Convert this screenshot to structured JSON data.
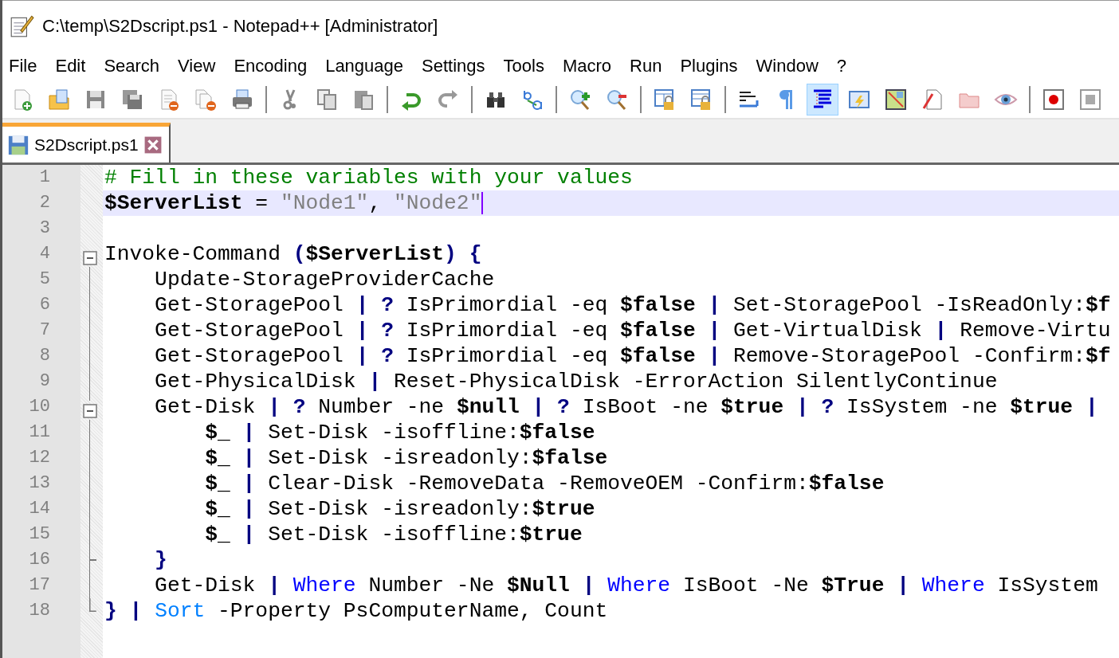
{
  "window": {
    "title": "C:\\temp\\S2Dscript.ps1 - Notepad++ [Administrator]"
  },
  "menu": [
    "File",
    "Edit",
    "Search",
    "View",
    "Encoding",
    "Language",
    "Settings",
    "Tools",
    "Macro",
    "Run",
    "Plugins",
    "Window",
    "?"
  ],
  "toolbar": {
    "groups": [
      {
        "buttons": [
          {
            "selected": false
          },
          {
            "selected": false
          },
          {
            "selected": false
          },
          {
            "selected": false
          },
          {
            "selected": false
          },
          {
            "selected": false
          },
          {
            "selected": false
          }
        ]
      },
      {
        "buttons": [
          {
            "selected": false
          },
          {
            "selected": false
          },
          {
            "selected": false
          }
        ]
      },
      {
        "buttons": [
          {
            "selected": false
          },
          {
            "selected": false
          }
        ]
      },
      {
        "buttons": [
          {
            "selected": false
          },
          {
            "selected": false
          }
        ]
      },
      {
        "buttons": [
          {
            "selected": false
          },
          {
            "selected": false
          }
        ]
      },
      {
        "buttons": [
          {
            "selected": false
          },
          {
            "selected": false
          }
        ]
      },
      {
        "buttons": [
          {
            "selected": false
          },
          {
            "selected": false
          },
          {
            "selected": true
          },
          {
            "selected": false
          },
          {
            "selected": false
          },
          {
            "selected": false
          },
          {
            "selected": false
          },
          {
            "selected": false
          }
        ]
      },
      {
        "buttons": [
          {
            "selected": false
          },
          {
            "selected": false
          }
        ]
      }
    ]
  },
  "tabs": [
    {
      "label": "S2Dscript.ps1",
      "selected": true
    }
  ],
  "editor": {
    "lines": [
      {
        "number": "1",
        "kind": "plain",
        "tokens": [
          {
            "kind": "comment",
            "text": "# Fill in these variables with your values"
          }
        ]
      },
      {
        "number": "2",
        "kind": "plain",
        "current": true,
        "tokens": [
          {
            "kind": "var",
            "text": "$ServerList"
          },
          {
            "kind": "plain",
            "text": " = "
          },
          {
            "kind": "string",
            "text": "\"Node1\""
          },
          {
            "kind": "plain",
            "text": ", "
          },
          {
            "kind": "string",
            "text": "\"Node2\""
          }
        ]
      },
      {
        "number": "3",
        "kind": "plain"
      },
      {
        "number": "4",
        "kind": "start",
        "tokens": [
          {
            "kind": "plain",
            "text": "Invoke-Command "
          },
          {
            "kind": "op",
            "text": "("
          },
          {
            "kind": "var",
            "text": "$ServerList"
          },
          {
            "kind": "op",
            "text": ") {"
          }
        ]
      },
      {
        "number": "5",
        "kind": "body",
        "tokens": [
          {
            "kind": "plain",
            "text": "    Update-StorageProviderCache"
          }
        ]
      },
      {
        "number": "6",
        "kind": "body",
        "tokens": [
          {
            "kind": "plain",
            "text": "    Get-StoragePool "
          },
          {
            "kind": "op",
            "text": "| ? "
          },
          {
            "kind": "plain",
            "text": "IsPrimordial -eq "
          },
          {
            "kind": "var",
            "text": "$false"
          },
          {
            "kind": "op",
            "text": " | "
          },
          {
            "kind": "plain",
            "text": "Set-StoragePool -IsReadOnly:"
          },
          {
            "kind": "var",
            "text": "$f"
          }
        ]
      },
      {
        "number": "7",
        "kind": "body",
        "tokens": [
          {
            "kind": "plain",
            "text": "    Get-StoragePool "
          },
          {
            "kind": "op",
            "text": "| ? "
          },
          {
            "kind": "plain",
            "text": "IsPrimordial -eq "
          },
          {
            "kind": "var",
            "text": "$false"
          },
          {
            "kind": "op",
            "text": " | "
          },
          {
            "kind": "plain",
            "text": "Get-VirtualDisk "
          },
          {
            "kind": "op",
            "text": "| "
          },
          {
            "kind": "plain",
            "text": "Remove-Virtu"
          }
        ]
      },
      {
        "number": "8",
        "kind": "body",
        "tokens": [
          {
            "kind": "plain",
            "text": "    Get-StoragePool "
          },
          {
            "kind": "op",
            "text": "| ? "
          },
          {
            "kind": "plain",
            "text": "IsPrimordial -eq "
          },
          {
            "kind": "var",
            "text": "$false"
          },
          {
            "kind": "op",
            "text": " | "
          },
          {
            "kind": "plain",
            "text": "Remove-StoragePool -Confirm:"
          },
          {
            "kind": "var",
            "text": "$f"
          }
        ]
      },
      {
        "number": "9",
        "kind": "body",
        "tokens": [
          {
            "kind": "plain",
            "text": "    Get-PhysicalDisk "
          },
          {
            "kind": "op",
            "text": "| "
          },
          {
            "kind": "plain",
            "text": "Reset-PhysicalDisk -ErrorAction SilentlyContinue"
          }
        ]
      },
      {
        "number": "10",
        "kind": "nested",
        "tokens": [
          {
            "kind": "plain",
            "text": "    Get-Disk "
          },
          {
            "kind": "op",
            "text": "| ? "
          },
          {
            "kind": "plain",
            "text": "Number -ne "
          },
          {
            "kind": "var",
            "text": "$null"
          },
          {
            "kind": "op",
            "text": " | ? "
          },
          {
            "kind": "plain",
            "text": "IsBoot -ne "
          },
          {
            "kind": "var",
            "text": "$true"
          },
          {
            "kind": "op",
            "text": " | ? "
          },
          {
            "kind": "plain",
            "text": "IsSystem -ne "
          },
          {
            "kind": "var",
            "text": "$true"
          },
          {
            "kind": "op",
            "text": " |"
          }
        ]
      },
      {
        "number": "11",
        "kind": "body",
        "tokens": [
          {
            "kind": "var",
            "text": "        $_"
          },
          {
            "kind": "op",
            "text": " | "
          },
          {
            "kind": "plain",
            "text": "Set-Disk -isoffline:"
          },
          {
            "kind": "var",
            "text": "$false"
          }
        ]
      },
      {
        "number": "12",
        "kind": "body",
        "tokens": [
          {
            "kind": "var",
            "text": "        $_"
          },
          {
            "kind": "op",
            "text": " | "
          },
          {
            "kind": "plain",
            "text": "Set-Disk -isreadonly:"
          },
          {
            "kind": "var",
            "text": "$false"
          }
        ]
      },
      {
        "number": "13",
        "kind": "body",
        "tokens": [
          {
            "kind": "var",
            "text": "        $_"
          },
          {
            "kind": "op",
            "text": " | "
          },
          {
            "kind": "plain",
            "text": "Clear-Disk -RemoveData -RemoveOEM -Confirm:"
          },
          {
            "kind": "var",
            "text": "$false"
          }
        ]
      },
      {
        "number": "14",
        "kind": "body",
        "tokens": [
          {
            "kind": "var",
            "text": "        $_"
          },
          {
            "kind": "op",
            "text": " | "
          },
          {
            "kind": "plain",
            "text": "Set-Disk -isreadonly:"
          },
          {
            "kind": "var",
            "text": "$true"
          }
        ]
      },
      {
        "number": "15",
        "kind": "body",
        "tokens": [
          {
            "kind": "var",
            "text": "        $_"
          },
          {
            "kind": "op",
            "text": " | "
          },
          {
            "kind": "plain",
            "text": "Set-Disk -isoffline:"
          },
          {
            "kind": "var",
            "text": "$true"
          }
        ]
      },
      {
        "number": "16",
        "kind": "close",
        "tokens": [
          {
            "kind": "op",
            "text": "    }"
          }
        ]
      },
      {
        "number": "17",
        "kind": "body",
        "tokens": [
          {
            "kind": "plain",
            "text": "    Get-Disk "
          },
          {
            "kind": "op",
            "text": "| "
          },
          {
            "kind": "keyword",
            "text": "Where "
          },
          {
            "kind": "plain",
            "text": "Number -Ne "
          },
          {
            "kind": "var",
            "text": "$Null"
          },
          {
            "kind": "op",
            "text": " | "
          },
          {
            "kind": "keyword",
            "text": "Where "
          },
          {
            "kind": "plain",
            "text": "IsBoot -Ne "
          },
          {
            "kind": "var",
            "text": "$True"
          },
          {
            "kind": "op",
            "text": " | "
          },
          {
            "kind": "keyword",
            "text": "Where "
          },
          {
            "kind": "plain",
            "text": "IsSystem"
          }
        ]
      },
      {
        "number": "18",
        "kind": "last",
        "tokens": [
          {
            "kind": "op",
            "text": "} | "
          },
          {
            "kind": "alias",
            "text": "Sort "
          },
          {
            "kind": "plain",
            "text": "-Property PsComputerName, Count"
          }
        ]
      }
    ]
  }
}
